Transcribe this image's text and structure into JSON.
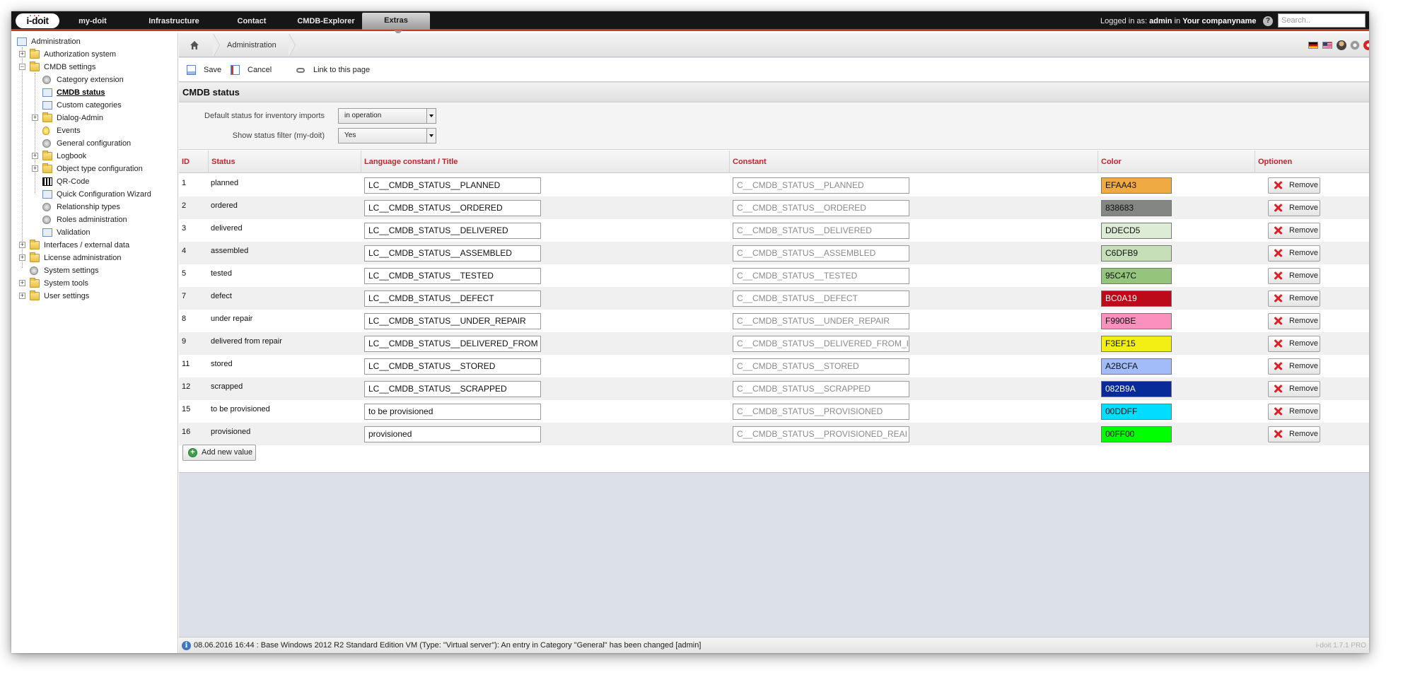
{
  "topbar": {
    "logo": "i-doit",
    "nav": [
      "my-doit",
      "Infrastructure",
      "Contact",
      "CMDB-Explorer",
      "Extras"
    ],
    "active_nav": "Extras",
    "logged_in_prefix": "Logged in as:",
    "user": "admin",
    "in_word": "in",
    "company": "Your companyname",
    "search_placeholder": "Search.."
  },
  "sidebar": {
    "items": [
      {
        "label": "Administration",
        "level": 0,
        "icon": "admin-icon"
      },
      {
        "label": "Authorization system",
        "level": 1,
        "icon": "folder-icon",
        "expandable": true
      },
      {
        "label": "CMDB settings",
        "level": 1,
        "icon": "folder-open-icon",
        "expandable": true,
        "expanded": true
      },
      {
        "label": "Category extension",
        "level": 2,
        "icon": "gear-icon"
      },
      {
        "label": "CMDB status",
        "level": 2,
        "icon": "status-grid-icon",
        "current": true
      },
      {
        "label": "Custom categories",
        "level": 2,
        "icon": "dialog-icon"
      },
      {
        "label": "Dialog-Admin",
        "level": 2,
        "icon": "folder-icon",
        "expandable": true
      },
      {
        "label": "Events",
        "level": 2,
        "icon": "bulb-icon"
      },
      {
        "label": "General configuration",
        "level": 2,
        "icon": "gear-icon"
      },
      {
        "label": "Logbook",
        "level": 2,
        "icon": "folder-icon",
        "expandable": true
      },
      {
        "label": "Object type configuration",
        "level": 2,
        "icon": "folder-icon",
        "expandable": true
      },
      {
        "label": "QR-Code",
        "level": 2,
        "icon": "qr-code-icon"
      },
      {
        "label": "Quick Configuration Wizard",
        "level": 2,
        "icon": "dialog-icon"
      },
      {
        "label": "Relationship types",
        "level": 2,
        "icon": "gear-icon"
      },
      {
        "label": "Roles administration",
        "level": 2,
        "icon": "gear-icon"
      },
      {
        "label": "Validation",
        "level": 2,
        "icon": "document-icon"
      },
      {
        "label": "Interfaces / external data",
        "level": 1,
        "icon": "folder-icon",
        "expandable": true
      },
      {
        "label": "License administration",
        "level": 1,
        "icon": "folder-icon",
        "expandable": true
      },
      {
        "label": "System settings",
        "level": 1,
        "icon": "gear-icon"
      },
      {
        "label": "System tools",
        "level": 1,
        "icon": "folder-icon",
        "expandable": true
      },
      {
        "label": "User settings",
        "level": 1,
        "icon": "folder-icon",
        "expandable": true
      }
    ]
  },
  "breadcrumb": {
    "current": "Administration"
  },
  "toolbar": {
    "save": "Save",
    "cancel": "Cancel",
    "link": "Link to this page"
  },
  "section": {
    "title": "CMDB status"
  },
  "settings": {
    "default_status_label": "Default status for inventory imports",
    "default_status_value": "in operation",
    "show_filter_label": "Show status filter (my-doit)",
    "show_filter_value": "Yes"
  },
  "table": {
    "headers": [
      "ID",
      "Status",
      "Language constant / Title",
      "Constant",
      "Color",
      "Optionen"
    ],
    "remove_label": "Remove",
    "rows": [
      {
        "id": "1",
        "status": "planned",
        "title": "LC__CMDB_STATUS__PLANNED",
        "constant": "C__CMDB_STATUS__PLANNED",
        "color": "EFAA43"
      },
      {
        "id": "2",
        "status": "ordered",
        "title": "LC__CMDB_STATUS__ORDERED",
        "constant": "C__CMDB_STATUS__ORDERED",
        "color": "838683"
      },
      {
        "id": "3",
        "status": "delivered",
        "title": "LC__CMDB_STATUS__DELIVERED",
        "constant": "C__CMDB_STATUS__DELIVERED",
        "color": "DDECD5"
      },
      {
        "id": "4",
        "status": "assembled",
        "title": "LC__CMDB_STATUS__ASSEMBLED",
        "constant": "C__CMDB_STATUS__ASSEMBLED",
        "color": "C6DFB9"
      },
      {
        "id": "5",
        "status": "tested",
        "title": "LC__CMDB_STATUS__TESTED",
        "constant": "C__CMDB_STATUS__TESTED",
        "color": "95C47C"
      },
      {
        "id": "7",
        "status": "defect",
        "title": "LC__CMDB_STATUS__DEFECT",
        "constant": "C__CMDB_STATUS__DEFECT",
        "color": "BC0A19"
      },
      {
        "id": "8",
        "status": "under repair",
        "title": "LC__CMDB_STATUS__UNDER_REPAIR",
        "constant": "C__CMDB_STATUS__UNDER_REPAIR",
        "color": "F990BE"
      },
      {
        "id": "9",
        "status": "delivered from repair",
        "title": "LC__CMDB_STATUS__DELIVERED_FROM",
        "constant": "C__CMDB_STATUS__DELIVERED_FROM_I",
        "color": "F3EF15"
      },
      {
        "id": "11",
        "status": "stored",
        "title": "LC__CMDB_STATUS__STORED",
        "constant": "C__CMDB_STATUS__STORED",
        "color": "A2BCFA"
      },
      {
        "id": "12",
        "status": "scrapped",
        "title": "LC__CMDB_STATUS__SCRAPPED",
        "constant": "C__CMDB_STATUS__SCRAPPED",
        "color": "082B9A"
      },
      {
        "id": "15",
        "status": "to be provisioned",
        "title": "to be provisioned",
        "constant": "C__CMDB_STATUS__PROVISIONED",
        "color": "00DDFF"
      },
      {
        "id": "16",
        "status": "provisioned",
        "title": "provisioned",
        "constant": "C__CMDB_STATUS__PROVISIONED_REAI",
        "color": "00FF00"
      }
    ],
    "add_label": "Add new value"
  },
  "statusbar": {
    "message": "08.06.2016 16:44 : Base Windows 2012 R2 Standard Edition VM (Type: \"Virtual server\"): An entry in Category \"General\" has been changed [admin]",
    "version": "i-doit 1.7.1 PRO"
  },
  "colors": {
    "accent": "#c23a1f",
    "header_text": "#c0262b"
  }
}
